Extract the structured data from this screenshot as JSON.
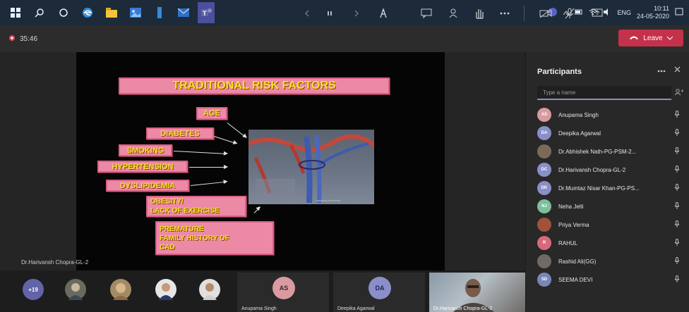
{
  "taskbar": {
    "icons": [
      "windows-start-icon",
      "search-icon",
      "cortana-icon",
      "edge-browser-icon",
      "file-explorer-icon",
      "photos-icon",
      "blue-app-icon",
      "mail-icon",
      "teams-icon"
    ],
    "clock_time": "10:11",
    "clock_date": "24-05-2020",
    "language": "ENG"
  },
  "meeting": {
    "elapsed": "35:46",
    "leave_label": "Leave",
    "leave_color": "#c4314b"
  },
  "slide": {
    "title": "TRADITIONAL RISK FACTORS",
    "labels": {
      "age": "AGE",
      "diabetes": "DIABETES",
      "smoking": "SMOKING",
      "hypertension": "HYPERTENSION",
      "dyslipidemia": "DYSLIPIDEMIA",
      "obesity_1": "OBESITY/",
      "obesity_2": "LACK OF EXERCISE",
      "premature_1": "PREMATURE",
      "premature_2": "FAMILY HISTORY OF",
      "premature_3": "CAD"
    },
    "image_credit": "www.pic-credit.com",
    "presenter": "Dr.Harivansh Chopra-GL-2"
  },
  "panel": {
    "title": "Participants",
    "search_placeholder": "Type a name",
    "participants": [
      {
        "initials": "AS",
        "name": "Anupama Singh",
        "color": "#d99aa0"
      },
      {
        "initials": "DA",
        "name": "Deepika Agarwal",
        "color": "#8a8fc9"
      },
      {
        "initials": "",
        "name": "Dr.Abhishek Nath-PG-PSM-2...",
        "color": "#7b6a58"
      },
      {
        "initials": "DC",
        "name": "Dr.Harivansh Chopra-GL-2",
        "color": "#8a8fc9"
      },
      {
        "initials": "DK",
        "name": "Dr.Mumtaz Nisar Khan-PG-PS...",
        "color": "#8a8fc9"
      },
      {
        "initials": "NJ",
        "name": "Neha Jetli",
        "color": "#7fbf9b"
      },
      {
        "initials": "",
        "name": "Priya Verma",
        "color": "#a0523a"
      },
      {
        "initials": "R",
        "name": "RAHUL",
        "color": "#d66a7a"
      },
      {
        "initials": "",
        "name": "Rashid Ali(GG)",
        "color": "#6f6a64"
      },
      {
        "initials": "SD",
        "name": "SEEMA DEVI",
        "color": "#7a86b8"
      }
    ]
  },
  "strip": {
    "overflow_count": "+19",
    "tiles": [
      {
        "initials": "AS",
        "name": "Anupama Singh",
        "color": "#d99aa0"
      },
      {
        "initials": "DA",
        "name": "Deepika Agarwal",
        "color": "#8a8fc9"
      }
    ],
    "video_name": "Dr.Harivansh Chopra-GL-2"
  }
}
